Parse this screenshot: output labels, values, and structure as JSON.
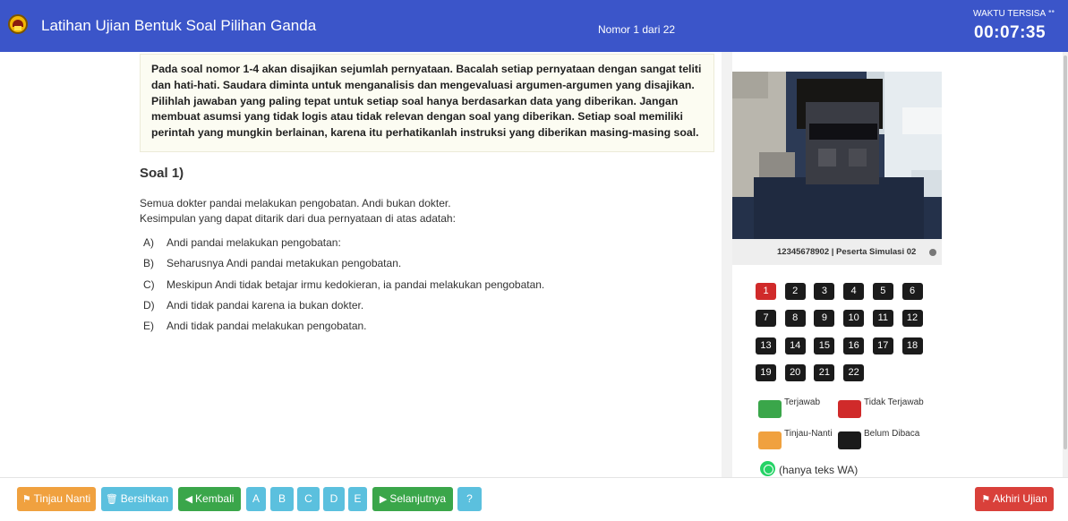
{
  "header": {
    "title": "Latihan Ujian Bentuk Soal Pilihan Ganda",
    "nomor": "Nomor 1 dari 22",
    "waktu_label": "WAKTU TERSISA",
    "timer": "00:07:35"
  },
  "instructions": "Pada soal nomor 1-4 akan disajikan sejumlah pernyataan. Bacalah setiap pernyataan dengan sangat teliti dan hati-hati. Saudara diminta untuk menganalisis dan mengevaluasi argumen-argumen yang disajikan. Pilihlah jawaban yang paling tepat untuk setiap soal hanya berdasarkan data yang diberikan. Jangan membuat asumsi yang tidak logis atau tidak relevan dengan soal yang diberikan. Setiap soal memiliki perintah yang mungkin berlainan, karena itu perhatikanlah instruksi yang diberikan masing-masing soal.",
  "question": {
    "title": "Soal 1)",
    "line1": "Semua dokter pandai melakukan pengobatan. Andi bukan dokter.",
    "line2": "Kesimpulan yang dapat ditarik dari dua pernyataan di atas adatah:",
    "options": [
      {
        "letter": "A)",
        "text": "Andi pandai melakukan pengobatan:"
      },
      {
        "letter": "B)",
        "text": "Seharusnya Andi pandai metakukan pengobatan."
      },
      {
        "letter": "C)",
        "text": "Meskipun Andi tidak betajar irmu kedokieran, ia pandai melakukan pengobatan."
      },
      {
        "letter": "D)",
        "text": "Andi tidak pandai karena ia bukan dokter."
      },
      {
        "letter": "E)",
        "text": "Andi tidak pandai melakukan pengobatan."
      }
    ]
  },
  "participant": {
    "id_label": "12345678902 | Peserta Simulasi 02"
  },
  "question_numbers": [
    "1",
    "2",
    "3",
    "4",
    "5",
    "6",
    "7",
    "8",
    "9",
    "10",
    "11",
    "12",
    "13",
    "14",
    "15",
    "16",
    "17",
    "18",
    "19",
    "20",
    "21",
    "22"
  ],
  "active_question": "1",
  "legend": {
    "answered": "Terjawab",
    "unanswered": "Tidak Terjawab",
    "review": "Tinjau-Nanti",
    "unread": "Belum Dibaca"
  },
  "whatsapp_note": "(hanya teks WA)",
  "footer": {
    "tinjau": "Tinjau Nanti",
    "bersihkan": "Bersihkan",
    "kembali": "Kembali",
    "answer_letters": [
      "A",
      "B",
      "C",
      "D",
      "E"
    ],
    "selanjutnya": "Selanjutnya",
    "akhiri": "Akhiri Ujian"
  },
  "colors": {
    "header": "#3b55c9",
    "answered": "#3aa64a",
    "unanswered": "#d02a2a",
    "review": "#f0a13f",
    "unread": "#1b1b1b",
    "info": "#5bc0de"
  }
}
